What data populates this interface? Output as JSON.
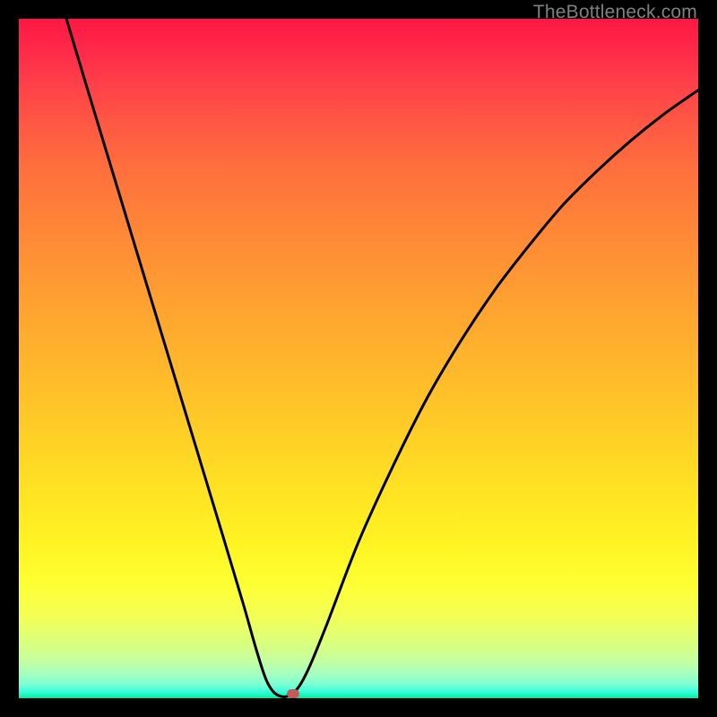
{
  "attribution": "TheBottleneck.com",
  "chart_data": {
    "type": "line",
    "title": "",
    "xlabel": "",
    "ylabel": "",
    "xlim": [
      0,
      100
    ],
    "ylim": [
      0,
      100
    ],
    "grid": false,
    "legend": false,
    "series": [
      {
        "name": "bottleneck-curve",
        "points": [
          {
            "x": 7.0,
            "y": 100.0
          },
          {
            "x": 10.0,
            "y": 90.0
          },
          {
            "x": 15.0,
            "y": 73.5
          },
          {
            "x": 20.0,
            "y": 57.0
          },
          {
            "x": 25.0,
            "y": 40.5
          },
          {
            "x": 30.0,
            "y": 24.0
          },
          {
            "x": 33.0,
            "y": 14.0
          },
          {
            "x": 35.0,
            "y": 7.0
          },
          {
            "x": 36.5,
            "y": 2.5
          },
          {
            "x": 38.0,
            "y": 0.5
          },
          {
            "x": 40.0,
            "y": 0.5
          },
          {
            "x": 42.0,
            "y": 3.0
          },
          {
            "x": 45.0,
            "y": 10.0
          },
          {
            "x": 50.0,
            "y": 23.0
          },
          {
            "x": 55.0,
            "y": 34.0
          },
          {
            "x": 60.0,
            "y": 44.0
          },
          {
            "x": 65.0,
            "y": 52.5
          },
          {
            "x": 70.0,
            "y": 60.0
          },
          {
            "x": 75.0,
            "y": 66.5
          },
          {
            "x": 80.0,
            "y": 72.5
          },
          {
            "x": 85.0,
            "y": 77.5
          },
          {
            "x": 90.0,
            "y": 82.0
          },
          {
            "x": 95.0,
            "y": 86.0
          },
          {
            "x": 100.0,
            "y": 89.5
          }
        ]
      }
    ],
    "marker": {
      "x": 40.4,
      "y": 0.7,
      "color": "#c35a57"
    },
    "background_gradient": {
      "top": "#ff1744",
      "mid": "#ffd000",
      "bottom": "#00f0a0"
    }
  }
}
